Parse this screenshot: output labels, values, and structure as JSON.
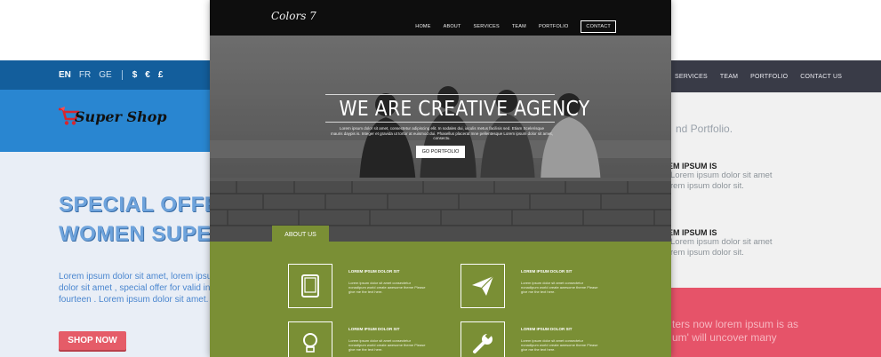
{
  "left": {
    "languages": [
      "EN",
      "FR",
      "GE"
    ],
    "currencies": [
      "$",
      "€",
      "£"
    ],
    "brand": "Super Shop",
    "offer_line1": "SPECIAL OFFER",
    "offer_line2": "WOMEN  SUPER",
    "desc_lines": [
      "Lorem ipsum dolor sit amet, lorem ipsum",
      "dolor sit amet , special offer for valid int",
      "fourteen . Lorem ipsum dolor sit amet."
    ],
    "shop_button": "SHOP NOW"
  },
  "center": {
    "logo": "Colors 7",
    "menu": [
      "HOME",
      "ABOUT",
      "SERVICES",
      "TEAM",
      "PORTFOLIO"
    ],
    "menu_active": "CONTACT",
    "hero_title": "WE ARE CREATIVE AGENCY",
    "hero_sub_lines": [
      "Lorem ipsum dolor sit amet, consectetur adipiscing elit. In sodales dui, iaculis metus facilisis sed. Etiam Scelerisque",
      "mauris daypis is. Integer et gravida ut tortor at euismod dui. Phasellus placerat mne pellentesque Lorem ipsum dolor sit amet, consectu."
    ],
    "go_button": "GO PORTFOLIO",
    "about_tab": "ABOUT US",
    "features": [
      {
        "title": "LOREM IPSUM DOLOR SIT",
        "desc": "Lorem ipsum dolor sit amet consectetur nonadipum world create awesome theme Please give me the text here.",
        "icon": "tablet-icon"
      },
      {
        "title": "LOREM IPSUM DOLOR SIT",
        "desc": "Lorem ipsum dolor sit amet consectetur nonadipum world create awesome theme Please give me the text here.",
        "icon": "paper-plane-icon"
      },
      {
        "title": "LOREM IPSUM DOLOR SIT",
        "desc": "Lorem ipsum dolor sit amet consectetur nonadipum world create awesome theme Please give me the text here.",
        "icon": "lightbulb-icon"
      },
      {
        "title": "LOREM IPSUM DOLOR SIT",
        "desc": "Lorem ipsum dolor sit amet consectetur nonadipum world create awesome theme Please give me the text here.",
        "icon": "wrench-icon"
      }
    ]
  },
  "right": {
    "menu": [
      "SERVICES",
      "TEAM",
      "PORTFOLIO",
      "CONTACT US"
    ],
    "intro": "nd Portfolio.",
    "blocks": [
      {
        "heading": "EM IPSUM IS",
        "lines": [
          "Lorem ipsum dolor sit amet",
          "rem ipsum dolor sit."
        ]
      },
      {
        "heading": "EM IPSUM IS",
        "lines": [
          "Lorem ipsum dolor sit amet",
          "rem ipsum dolor sit."
        ]
      }
    ],
    "pink_lines": [
      "ters now lorem ipsum is as",
      "um' will uncover many"
    ]
  },
  "colors": {
    "left_topbar": "#135e9c",
    "left_brandbar": "#2986d1",
    "shop_button": "#e55c68",
    "center_nav": "#0e0e0e",
    "about_green": "#7a8f35",
    "right_nav": "#393b47",
    "right_pink": "#e65369"
  }
}
